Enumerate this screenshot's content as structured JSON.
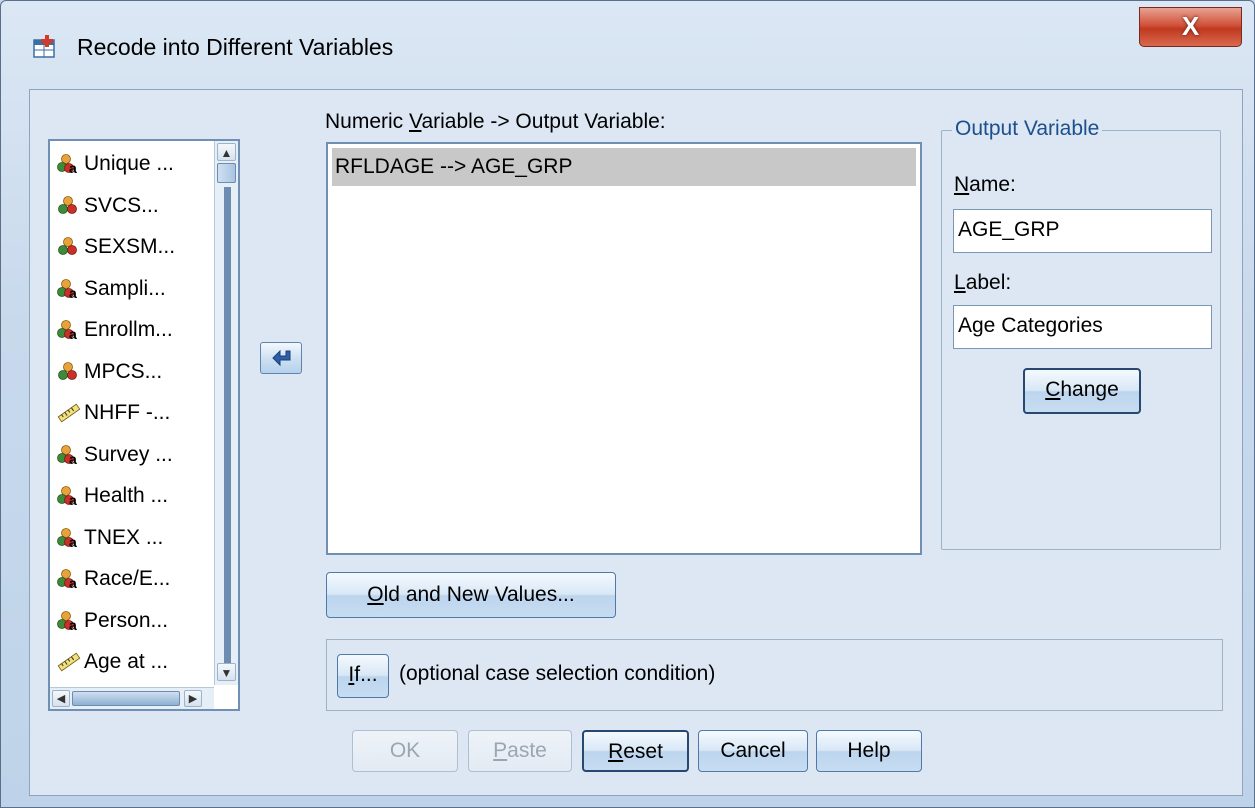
{
  "window": {
    "title": "Recode into Different Variables",
    "close_glyph": "X"
  },
  "variables": {
    "items": [
      {
        "label": "Unique ...",
        "icon": "nominal-string-icon"
      },
      {
        "label": "SVCS...",
        "icon": "nominal-icon"
      },
      {
        "label": "SEXSM...",
        "icon": "nominal-icon"
      },
      {
        "label": "Sampli...",
        "icon": "nominal-string-icon"
      },
      {
        "label": "Enrollm...",
        "icon": "nominal-string-icon"
      },
      {
        "label": "MPCS...",
        "icon": "nominal-icon"
      },
      {
        "label": "NHFF -...",
        "icon": "ruler-scale-icon"
      },
      {
        "label": "Survey ...",
        "icon": "nominal-string-icon"
      },
      {
        "label": "Health ...",
        "icon": "nominal-string-icon"
      },
      {
        "label": "TNEX ...",
        "icon": "nominal-string-icon"
      },
      {
        "label": "Race/E...",
        "icon": "nominal-string-icon"
      },
      {
        "label": "Person...",
        "icon": "nominal-string-icon"
      },
      {
        "label": "Age at ...",
        "icon": "ruler-scale-icon"
      }
    ]
  },
  "mapping": {
    "label_pre": "Numeric ",
    "label_mnemonic": "V",
    "label_post": "ariable -> Output Variable:",
    "rows": [
      "RFLDAGE --> AGE_GRP"
    ]
  },
  "output_variable": {
    "legend": "Output Variable",
    "name_mnemonic": "N",
    "name_rest": "ame:",
    "name_value": "AGE_GRP",
    "label_mnemonic": "L",
    "label_rest": "abel:",
    "label_value": "Age Categories",
    "change_mnemonic": "C",
    "change_rest": "hange"
  },
  "old_new": {
    "mnemonic": "O",
    "rest": "ld and New Values..."
  },
  "if_section": {
    "button_mnemonic": "I",
    "button_rest": "f...",
    "description": "(optional case selection condition)"
  },
  "footer": {
    "ok": "OK",
    "paste_mnemonic": "P",
    "paste_rest": "aste",
    "reset_mnemonic": "R",
    "reset_rest": "eset",
    "cancel": "Cancel",
    "help": "Help"
  }
}
